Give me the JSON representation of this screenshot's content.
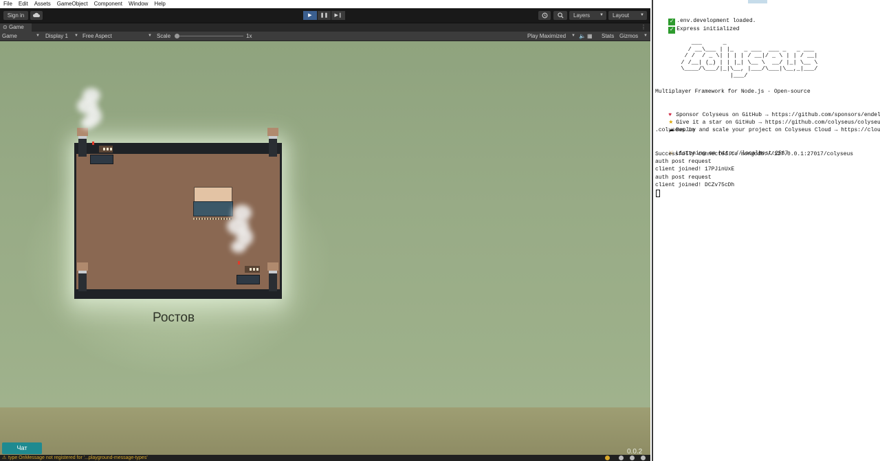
{
  "menu": [
    "File",
    "Edit",
    "Assets",
    "GameObject",
    "Component",
    "Window",
    "Help"
  ],
  "toolbar": {
    "sign_in": "Sign in",
    "layers": "Layers",
    "layout": "Layout",
    "play_icon": "▶",
    "pause_icon": "❚❚",
    "step_icon": "▶❙"
  },
  "tab": {
    "label": "Game"
  },
  "gamebar": {
    "view_select": "Game",
    "display": "Display 1",
    "aspect": "Free Aspect",
    "scale_label": "Scale",
    "scale_value": "1x",
    "play_mode": "Play Maximized",
    "stats": "Stats",
    "gizmos": "Gizmos"
  },
  "game": {
    "city_name": "Ростов",
    "version": "0.0.2",
    "chat_button": "Чат"
  },
  "statusbar": {
    "message": "type OnMessage not registered for '...playground-message-types'"
  },
  "console": {
    "line_env": ".env.development loaded.",
    "line_express": "Express initialized",
    "ascii_art": "       ___      _\n      / __\\___ | |_   _ ___  ___ _   _ ___\n     / /  / _ \\| | | | / __|/ _ \\ | | / __|\n    / /__| (_) | | |_| \\__ \\  __/ |_| \\__ \\\n    \\____/\\___/|_|\\__, |___/\\___|\\__,_|___/\n                  |___/",
    "tagline": "Multiplayer Framework for Node.js · Open-source",
    "sponsor": "Sponsor Colyseus on GitHub → https://github.com/sponsors/endel",
    "star": "Give it a star on GitHub → https://github.com/colyseus/colyseus",
    "deploy_1": "Deploy and scale your project on Colyseus Cloud → https://cloud",
    "deploy_2": ".colyseus.io",
    "listening": "Listening on http://localhost:2567",
    "mongo": "Successfully connected to mongodb://127.0.0.1:27017/colyseus",
    "auth_1": "auth post request",
    "join_1": "client joined! 17PJinUxE",
    "auth_2": "auth post request",
    "join_2": "client joined! DCZv75cDh"
  }
}
